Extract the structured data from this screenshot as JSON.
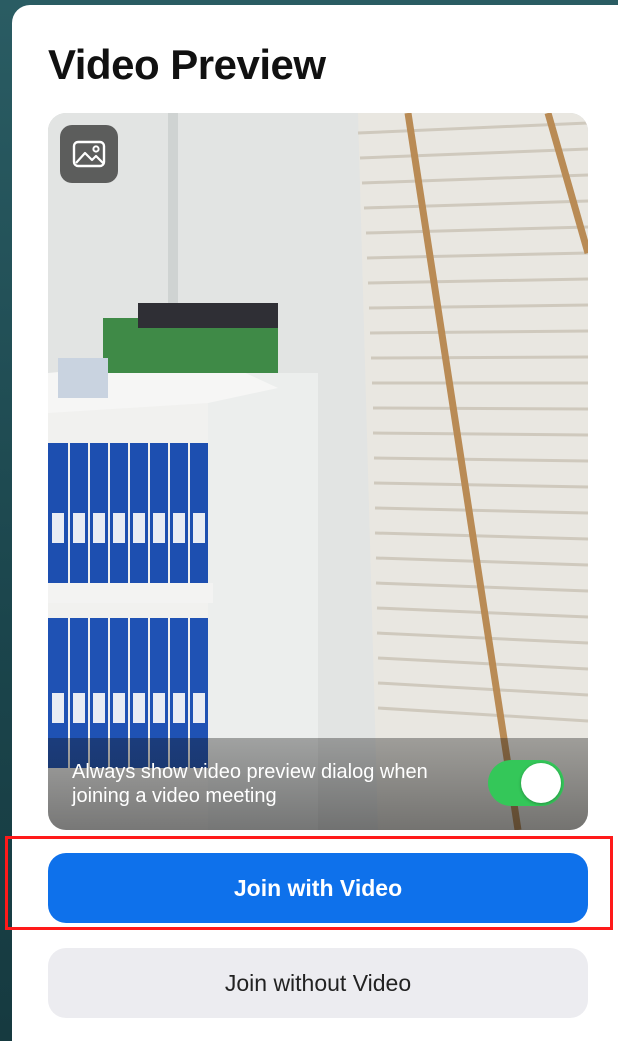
{
  "dialog": {
    "title": "Video Preview"
  },
  "preview": {
    "background_button_icon": "image-icon",
    "always_show_text": "Always show video preview dialog when joining a video meeting",
    "always_show_enabled": true
  },
  "actions": {
    "join_with_video_label": "Join with Video",
    "join_without_video_label": "Join without Video"
  },
  "colors": {
    "primary_button": "#0e71eb",
    "secondary_button": "#ececf0",
    "switch_on": "#34c759",
    "highlight": "#ff1a1a"
  }
}
